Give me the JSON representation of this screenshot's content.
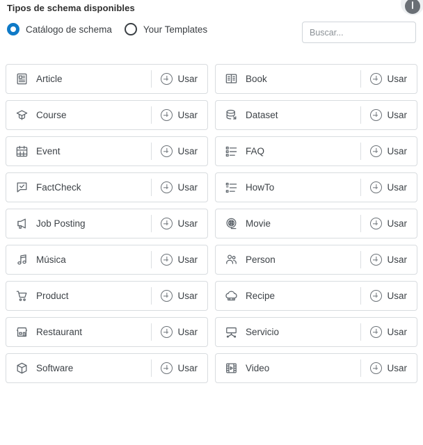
{
  "header": {
    "title": "Tipos de schema disponibles",
    "info_icon": "info-circle-icon"
  },
  "options": {
    "catalog_label": "Catálogo de schema",
    "templates_label": "Your Templates",
    "selected": "catalog"
  },
  "search": {
    "value": "",
    "placeholder": "Buscar..."
  },
  "cards": [
    {
      "label": "Article",
      "icon": "article-icon",
      "action": "Usar"
    },
    {
      "label": "Book",
      "icon": "book-icon",
      "action": "Usar"
    },
    {
      "label": "Course",
      "icon": "graduation-cap-icon",
      "action": "Usar"
    },
    {
      "label": "Dataset",
      "icon": "database-icon",
      "action": "Usar"
    },
    {
      "label": "Event",
      "icon": "calendar-icon",
      "action": "Usar"
    },
    {
      "label": "FAQ",
      "icon": "list-icon",
      "action": "Usar"
    },
    {
      "label": "FactCheck",
      "icon": "check-bubble-icon",
      "action": "Usar"
    },
    {
      "label": "HowTo",
      "icon": "numbered-list-icon",
      "action": "Usar"
    },
    {
      "label": "Job Posting",
      "icon": "megaphone-icon",
      "action": "Usar"
    },
    {
      "label": "Movie",
      "icon": "film-reel-icon",
      "action": "Usar"
    },
    {
      "label": "Música",
      "icon": "music-note-icon",
      "action": "Usar"
    },
    {
      "label": "Person",
      "icon": "people-icon",
      "action": "Usar"
    },
    {
      "label": "Product",
      "icon": "shopping-cart-icon",
      "action": "Usar"
    },
    {
      "label": "Recipe",
      "icon": "chef-hat-icon",
      "action": "Usar"
    },
    {
      "label": "Restaurant",
      "icon": "storefront-icon",
      "action": "Usar"
    },
    {
      "label": "Servicio",
      "icon": "service-desk-icon",
      "action": "Usar"
    },
    {
      "label": "Software",
      "icon": "box-3d-icon",
      "action": "Usar"
    },
    {
      "label": "Video",
      "icon": "film-strip-icon",
      "action": "Usar"
    }
  ],
  "colors": {
    "accent": "#0f7ac7",
    "card_border": "#d8dcdf",
    "text": "#3d4247",
    "icon": "#5d646b"
  }
}
